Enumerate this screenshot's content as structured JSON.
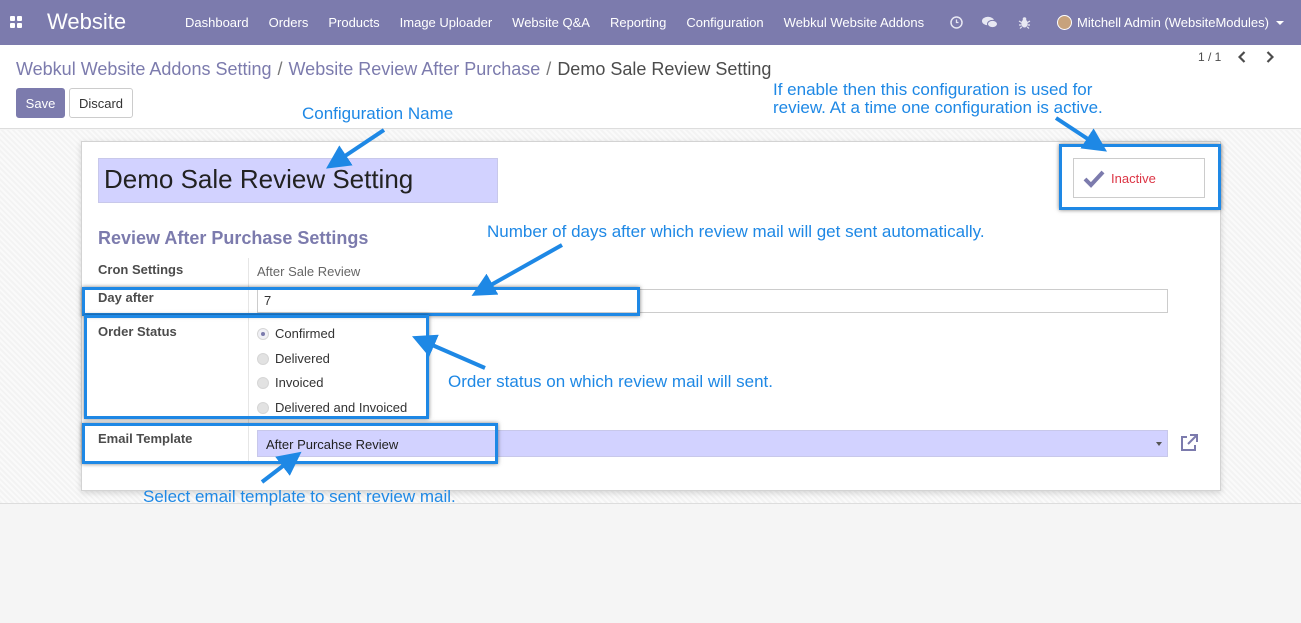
{
  "navbar": {
    "brand": "Website",
    "menu": [
      "Dashboard",
      "Orders",
      "Products",
      "Image Uploader",
      "Website Q&A",
      "Reporting",
      "Configuration",
      "Webkul Website Addons"
    ],
    "user": "Mitchell Admin (WebsiteModules)",
    "icons": [
      "clock-icon",
      "chat-icon",
      "bug-icon"
    ]
  },
  "breadcrumb": {
    "items": [
      "Webkul Website Addons Setting",
      "Website Review After Purchase"
    ],
    "current": "Demo Sale Review Setting",
    "separator": "/"
  },
  "buttons": {
    "save": "Save",
    "discard": "Discard"
  },
  "pager": {
    "value": "1 / 1"
  },
  "form": {
    "name": "Demo Sale Review Setting",
    "active_toggle": "Inactive",
    "section_title": "Review After Purchase Settings",
    "cron_label": "Cron Settings",
    "cron_value": "After Sale Review",
    "day_label": "Day after",
    "day_value": "7",
    "order_status_label": "Order Status",
    "order_status_options": [
      "Confirmed",
      "Delivered",
      "Invoiced",
      "Delivered and Invoiced"
    ],
    "order_status_selected": "Confirmed",
    "email_label": "Email Template",
    "email_value": "After Purcahse Review"
  },
  "annotations": {
    "config_name": "Configuration Name",
    "active_line1": "If enable then this configuration is used for",
    "active_line2": "review. At a time one configuration is active.",
    "day_note": "Number of days after which review mail will get sent automatically.",
    "status_note": "Order status on which review mail will sent.",
    "email_note": "Select email template to sent review mail."
  },
  "colors": {
    "brand": "#7c7bad",
    "annotation": "#1e88e5",
    "inactive": "#dc3545",
    "required_field": "#d2d2ff"
  }
}
